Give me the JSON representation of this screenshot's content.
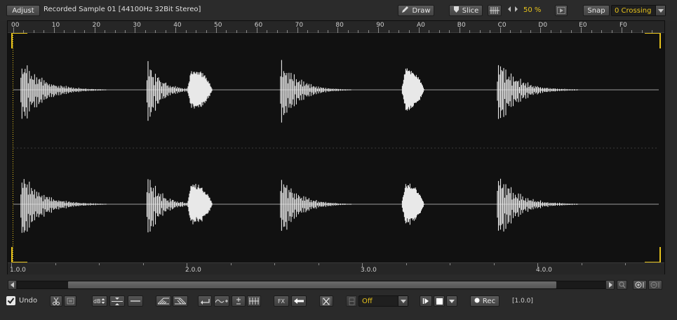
{
  "toolbar": {
    "adjust_label": "Adjust",
    "title": "Recorded Sample 01 [44100Hz 32Bit Stereo]",
    "draw_label": "Draw",
    "slice_label": "Slice",
    "zoom_value": "50 %",
    "snap_label": "Snap",
    "snap_mode": "0 Crossing"
  },
  "ruler_top": {
    "labels": [
      "00",
      "10",
      "20",
      "30",
      "40",
      "50",
      "60",
      "70",
      "80",
      "90",
      "A0",
      "B0",
      "C0",
      "D0",
      "E0",
      "F0"
    ]
  },
  "ruler_bottom": {
    "labels": [
      "1.0.0",
      "2.0.0",
      "3.0.0",
      "4.0.0"
    ]
  },
  "bottom": {
    "undo_label": "Undo",
    "undo_checked": true,
    "fx_label": "FX",
    "loop_mode": "Off",
    "rec_label": "Rec",
    "position": "[1.0.0]"
  },
  "colors": {
    "accent": "#e6c21c",
    "waveform": "#e8e8e8",
    "background": "#111111"
  },
  "waveform": {
    "length": 256,
    "hits": [
      {
        "start": 3,
        "type": "kick",
        "length": 34
      },
      {
        "start": 53,
        "type": "kick",
        "length": 22
      },
      {
        "start": 69,
        "type": "snare",
        "length": 10
      },
      {
        "start": 106,
        "type": "kick",
        "length": 28
      },
      {
        "start": 154,
        "type": "snare",
        "length": 9
      },
      {
        "start": 192,
        "type": "kick",
        "length": 32
      }
    ]
  },
  "scroll": {
    "position": 0.0,
    "visible_fraction": 0.83
  }
}
